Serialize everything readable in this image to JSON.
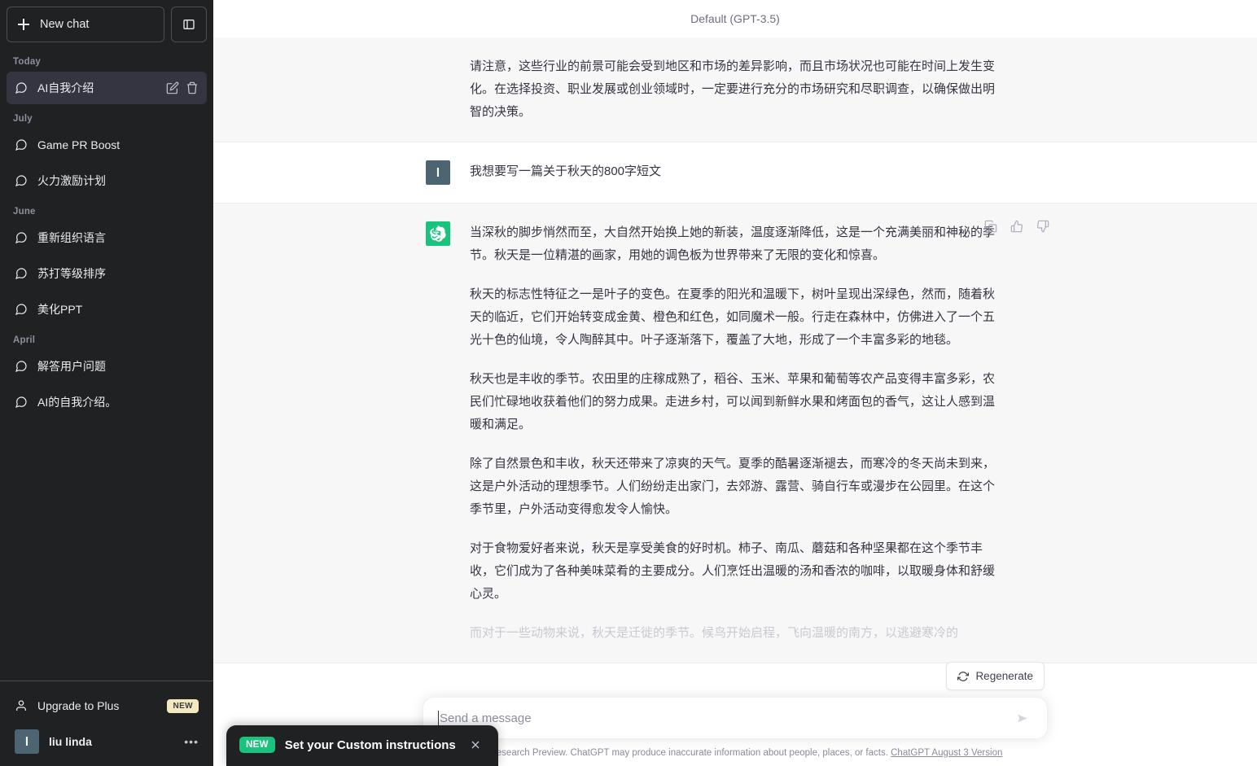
{
  "sidebar": {
    "new_chat_label": "New chat",
    "new_chat_icon": "plus-icon",
    "toggle_icon": "sidebar-toggle-icon",
    "groups": [
      {
        "label": "Today",
        "items": [
          {
            "title": "AI自我介绍",
            "active": true,
            "icon": "chat-bubble-icon",
            "edit_icon": "pencil-icon",
            "delete_icon": "trash-icon"
          }
        ]
      },
      {
        "label": "July",
        "items": [
          {
            "title": "Game PR Boost",
            "active": false,
            "icon": "chat-bubble-icon"
          },
          {
            "title": "火力激励计划",
            "active": false,
            "icon": "chat-bubble-icon"
          }
        ]
      },
      {
        "label": "June",
        "items": [
          {
            "title": "重新组织语言",
            "active": false,
            "icon": "chat-bubble-icon"
          },
          {
            "title": "苏打等级排序",
            "active": false,
            "icon": "chat-bubble-icon"
          },
          {
            "title": "美化PPT",
            "active": false,
            "icon": "chat-bubble-icon"
          }
        ]
      },
      {
        "label": "April",
        "items": [
          {
            "title": "解答用户问题",
            "active": false,
            "icon": "chat-bubble-icon"
          },
          {
            "title": "AI的自我介绍。",
            "active": false,
            "icon": "chat-bubble-icon"
          }
        ]
      }
    ],
    "upgrade": {
      "label": "Upgrade to Plus",
      "badge": "NEW",
      "icon": "person-icon"
    },
    "account": {
      "name": "liu linda",
      "avatar_initial": "l",
      "menu_icon": "ellipsis-icon"
    }
  },
  "header": {
    "model_label": "Default (GPT-3.5)"
  },
  "messages": [
    {
      "role": "assistant",
      "avatar_icon": "openai-logo-icon",
      "partial_top": true,
      "paragraphs": [
        "请注意，这些行业的前景可能会受到地区和市场的差异影响，而且市场状况也可能在时间上发生变化。在选择投资、职业发展或创业领域时，一定要进行充分的市场研究和尽职调查，以确保做出明智的决策。"
      ]
    },
    {
      "role": "user",
      "avatar_initial": "l",
      "paragraphs": [
        "我想要写一篇关于秋天的800字短文"
      ]
    },
    {
      "role": "assistant",
      "avatar_icon": "openai-logo-icon",
      "actions": [
        {
          "name": "copy-icon",
          "label": "Copy"
        },
        {
          "name": "thumbs-up-icon",
          "label": "Good response"
        },
        {
          "name": "thumbs-down-icon",
          "label": "Bad response"
        }
      ],
      "paragraphs": [
        "当深秋的脚步悄然而至，大自然开始换上她的新装，温度逐渐降低，这是一个充满美丽和神秘的季节。秋天是一位精湛的画家，用她的调色板为世界带来了无限的变化和惊喜。",
        "秋天的标志性特征之一是叶子的变色。在夏季的阳光和温暖下，树叶呈现出深绿色，然而，随着秋天的临近，它们开始转变成金黄、橙色和红色，如同魔术一般。行走在森林中，仿佛进入了一个五光十色的仙境，令人陶醉其中。叶子逐渐落下，覆盖了大地，形成了一个丰富多彩的地毯。",
        "秋天也是丰收的季节。农田里的庄稼成熟了，稻谷、玉米、苹果和葡萄等农产品变得丰富多彩，农民们忙碌地收获着他们的努力成果。走进乡村，可以闻到新鲜水果和烤面包的香气，这让人感到温暖和满足。",
        "除了自然景色和丰收，秋天还带来了凉爽的天气。夏季的酷暑逐渐褪去，而寒冷的冬天尚未到来，这是户外活动的理想季节。人们纷纷走出家门，去郊游、露营、骑自行车或漫步在公园里。在这个季节里，户外活动变得愈发令人愉快。",
        "对于食物爱好者来说，秋天是享受美食的好时机。柿子、南瓜、蘑菇和各种坚果都在这个季节丰收，它们成为了各种美味菜肴的主要成分。人们烹饪出温暖的汤和香浓的咖啡，以取暖身体和舒缓心灵。",
        "而对于一些动物来说，秋天是迁徙的季节。候鸟开始启程，飞向温暖的南方，以逃避寒冷的"
      ]
    }
  ],
  "composer": {
    "placeholder": "Send a message",
    "value": "",
    "send_icon": "send-arrow-icon",
    "regenerate_label": "Regenerate",
    "regenerate_icon": "refresh-icon"
  },
  "footer": {
    "disclaimer": "Free Research Preview. ChatGPT may produce inaccurate information about people, places, or facts.",
    "version_link": "ChatGPT August 3 Version"
  },
  "toast": {
    "badge": "NEW",
    "text": "Set your Custom instructions",
    "close_icon": "close-icon"
  },
  "colors": {
    "sidebar_bg": "#202123",
    "assistant_bg": "#f7f7f8",
    "user_bg": "#ffffff",
    "accent_green": "#19c37d",
    "badge_yellow": "#f3e8bf",
    "avatar_slate": "#4d6472"
  }
}
